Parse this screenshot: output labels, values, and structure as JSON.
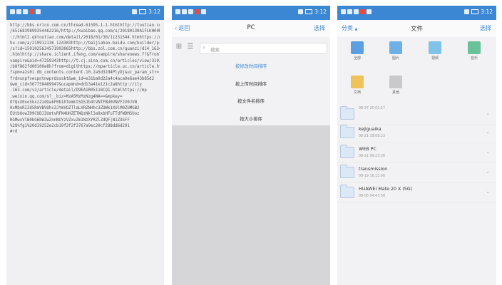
{
  "phones": [
    {
      "status": {
        "time": "3:12"
      },
      "text_lines": [
        "http://bbs.orico.com.cn/thread-61595-1-1.htmlhttp://toutiao.com/item",
        "/6516839899354462216/http://kuaibao.qq.com/s/20180130A1FLKH00http",
        "://html2.qktoutiao.com/detail/2018/01/30/11231544.htmhttps://www.so",
        "hu.com/a/219912136_124303http://baijiahao.baidu.com/builder/preview",
        "/s?id=1591025624571993065http://bbs.zol.com.cn/quanzi/d14_16347",
        ".htmlhttp://share.iclient.ifeng.com/vampire/sharenews.f?&fromTuser=",
        "vampire&aid=47259343http://t.cj.sina.com.cn/articles/view/3103286613",
        "/b8f862fd00100e8h?from=digithttps://mparticle.uc.cn/article.html",
        "?spm=a2s0i.db_contents.content.10.2a5d32d4PlyDj&uc_param_str=",
        "frdnsnpfvecpntnwprdssskt&wm_id=e31ba0d22a4c4aca0e6ae43b85d2",
        "&wm_cid=367758489947&ucapmnd=dd13a41e121c2a8http://ily",
        ".163.com/v2/article/detail/D9EA1R05118CQ1.htmlhttps://mp",
        ".weixin.qq.com/s?__biz=MzA5MzMzNzg4NA==&mpkey=",
        "OTQxX0xoSkxzZzdOakF0b1hTemktSGSJb4tVNTFBU0VNVF2V0JVN",
        "0xMbnRIZd5RmVBVUhc3JYmVOZTlaLVRZNHhc3ZOWk1XUlM0ZUMGB2",
        "EUtbUowZ09CUDJ2UmtvRFN4UHZETWQzNkl3a9xbHFuTTdfWDMSUoz",
        "RGMwxVlB0bG6bWZwZnnNUYzVZxvZm1NzXYRZlZdQF|N1ZOSFF",
        "%28%fg1%20d19252e2cb19f2f2f3767a9ec20cf288dd6d291",
        "#rd"
      ]
    },
    {
      "status": {
        "time": "3:12"
      },
      "back_label": "返回",
      "title": "PC",
      "select_label": "选择",
      "search_placeholder": "搜索",
      "sort_options": [
        {
          "label": "按修改时间排序",
          "active": true
        },
        {
          "label": "按上传时间排序",
          "active": false
        },
        {
          "label": "按文件名排序",
          "active": false
        },
        {
          "label": "按大小排序",
          "active": false
        }
      ]
    },
    {
      "status": {
        "time": "3:12"
      },
      "category_label": "分类",
      "title": "文件",
      "select_label": "选择",
      "categories": [
        {
          "label": "全部",
          "icon": "folder-icon",
          "color": "#5aa0e0"
        },
        {
          "label": "图片",
          "icon": "image-icon",
          "color": "#6eb0e6"
        },
        {
          "label": "视频",
          "icon": "video-icon",
          "color": "#7fc4e8"
        },
        {
          "label": "音乐",
          "icon": "music-icon",
          "color": "#6ac29a"
        },
        {
          "label": "文档",
          "icon": "document-icon",
          "color": "#f0c35a"
        },
        {
          "label": "其他",
          "icon": "more-icon",
          "color": "#c9c9c9"
        }
      ],
      "files": [
        {
          "name": "",
          "date": "08-27 20:02:17"
        },
        {
          "name": "kejiguaika",
          "date": "08-21 19:08:23"
        },
        {
          "name": "WEB PC",
          "date": "08-21 09:23:26"
        },
        {
          "name": "transmission",
          "date": "08-19 16:11:00"
        },
        {
          "name": "HUAWEI Mate 20 X (5G)",
          "date": "08-06 04:43:58"
        }
      ]
    }
  ]
}
